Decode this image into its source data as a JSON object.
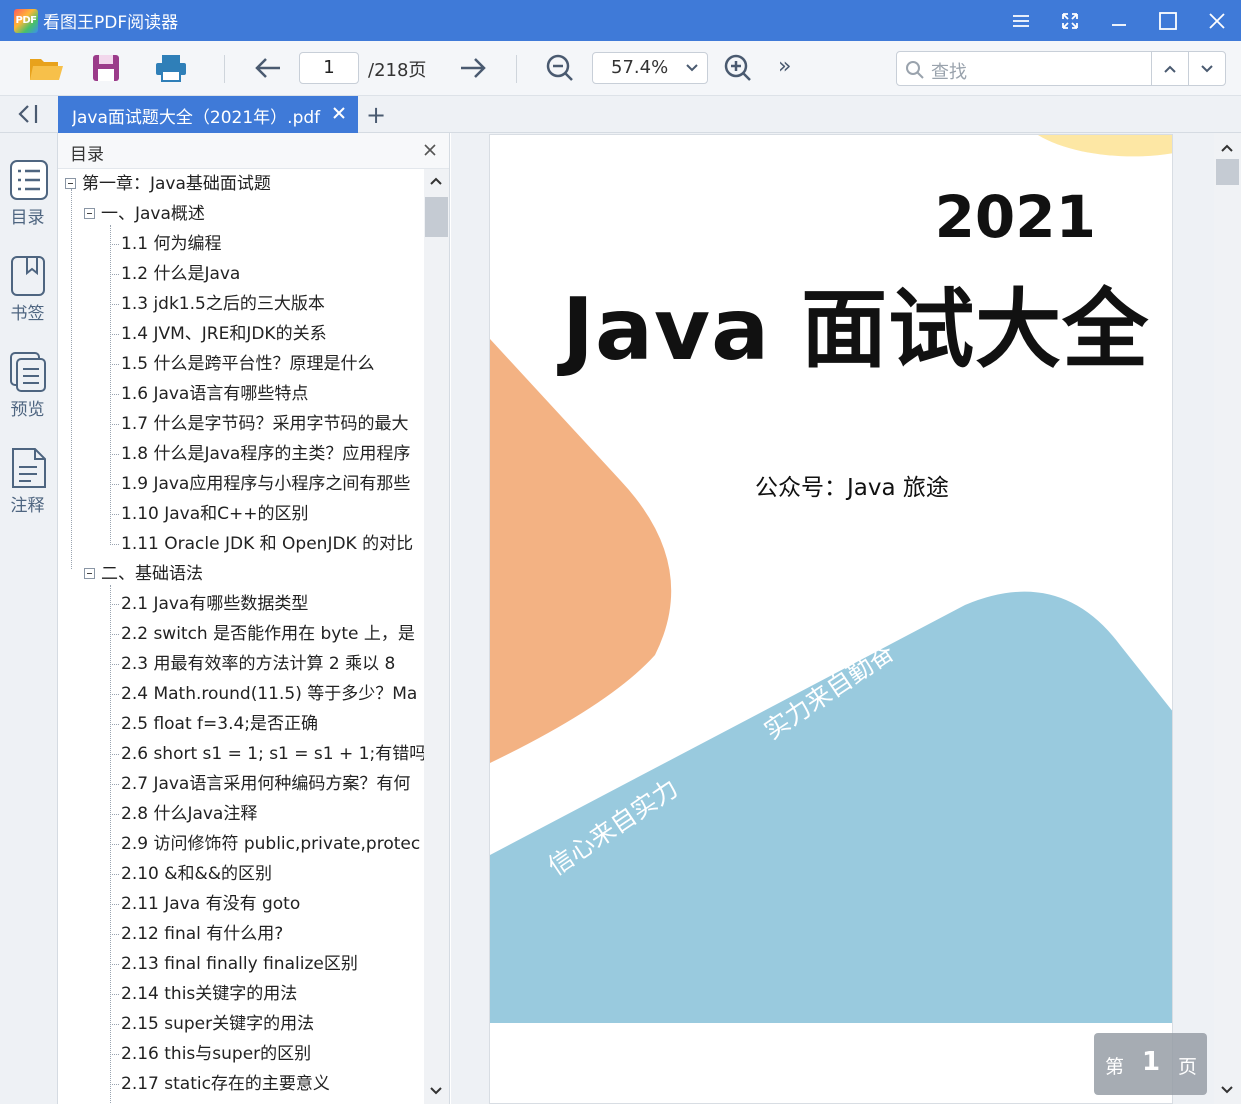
{
  "window": {
    "app_title": "看图王PDF阅读器",
    "logo_text": "PDF"
  },
  "toolbar": {
    "current_page": "1",
    "total_pages": "/218页",
    "zoom": "57.4%",
    "more": "»",
    "search_placeholder": "查找"
  },
  "tabs": {
    "active_label": "Java面试题大全（2021年）.pdf",
    "add_label": "+"
  },
  "rail": [
    {
      "label": "目录",
      "icon": "list-icon"
    },
    {
      "label": "书签",
      "icon": "bookmark-icon"
    },
    {
      "label": "预览",
      "icon": "pages-icon"
    },
    {
      "label": "注释",
      "icon": "annotation-icon"
    }
  ],
  "outline": {
    "title": "目录",
    "items": [
      {
        "level": 0,
        "label": "第一章：Java基础面试题"
      },
      {
        "level": 1,
        "label": "一、Java概述"
      },
      {
        "level": 2,
        "label": "1.1 何为编程"
      },
      {
        "level": 2,
        "label": "1.2 什么是Java"
      },
      {
        "level": 2,
        "label": "1.3 jdk1.5之后的三大版本"
      },
      {
        "level": 2,
        "label": "1.4 JVM、JRE和JDK的关系"
      },
      {
        "level": 2,
        "label": "1.5 什么是跨平台性？原理是什么"
      },
      {
        "level": 2,
        "label": "1.6 Java语言有哪些特点"
      },
      {
        "level": 2,
        "label": "1.7 什么是字节码？采用字节码的最大"
      },
      {
        "level": 2,
        "label": "1.8 什么是Java程序的主类？应用程序"
      },
      {
        "level": 2,
        "label": "1.9 Java应用程序与小程序之间有那些"
      },
      {
        "level": 2,
        "label": "1.10 Java和C++的区别"
      },
      {
        "level": 2,
        "label": "1.11 Oracle JDK 和 OpenJDK 的对比"
      },
      {
        "level": 1,
        "label": "二、基础语法"
      },
      {
        "level": 2,
        "label": "2.1 Java有哪些数据类型"
      },
      {
        "level": 2,
        "label": "2.2 switch 是否能作用在 byte 上，是"
      },
      {
        "level": 2,
        "label": "2.3 用最有效率的方法计算 2 乘以 8"
      },
      {
        "level": 2,
        "label": "2.4 Math.round(11.5) 等于多少？Ma"
      },
      {
        "level": 2,
        "label": "2.5 float f=3.4;是否正确"
      },
      {
        "level": 2,
        "label": "2.6 short s1 = 1; s1 = s1 + 1;有错吗?"
      },
      {
        "level": 2,
        "label": "2.7 Java语言采用何种编码方案？有何"
      },
      {
        "level": 2,
        "label": "2.8 什么Java注释"
      },
      {
        "level": 2,
        "label": "2.9 访问修饰符 public,private,protec"
      },
      {
        "level": 2,
        "label": "2.10 &和&&的区别"
      },
      {
        "level": 2,
        "label": "2.11 Java 有没有 goto"
      },
      {
        "level": 2,
        "label": "2.12 final 有什么用?"
      },
      {
        "level": 2,
        "label": "2.13 final finally finalize区别"
      },
      {
        "level": 2,
        "label": "2.14 this关键字的用法"
      },
      {
        "level": 2,
        "label": "2.15 super关键字的用法"
      },
      {
        "level": 2,
        "label": "2.16 this与super的区别"
      },
      {
        "level": 2,
        "label": "2.17 static存在的主要意义"
      }
    ]
  },
  "document": {
    "year": "2021",
    "title": "Java 面试大全",
    "subtitle": "公众号：Java 旅途",
    "slogan_1": "实力来自勤奋",
    "slogan_2": "信心来自实力",
    "colors": {
      "orange": "#f3b283",
      "blue": "#99cade",
      "yellow": "#fde7a4"
    }
  },
  "page_indicator": {
    "prefix": "第",
    "number": "1",
    "suffix": "页"
  }
}
